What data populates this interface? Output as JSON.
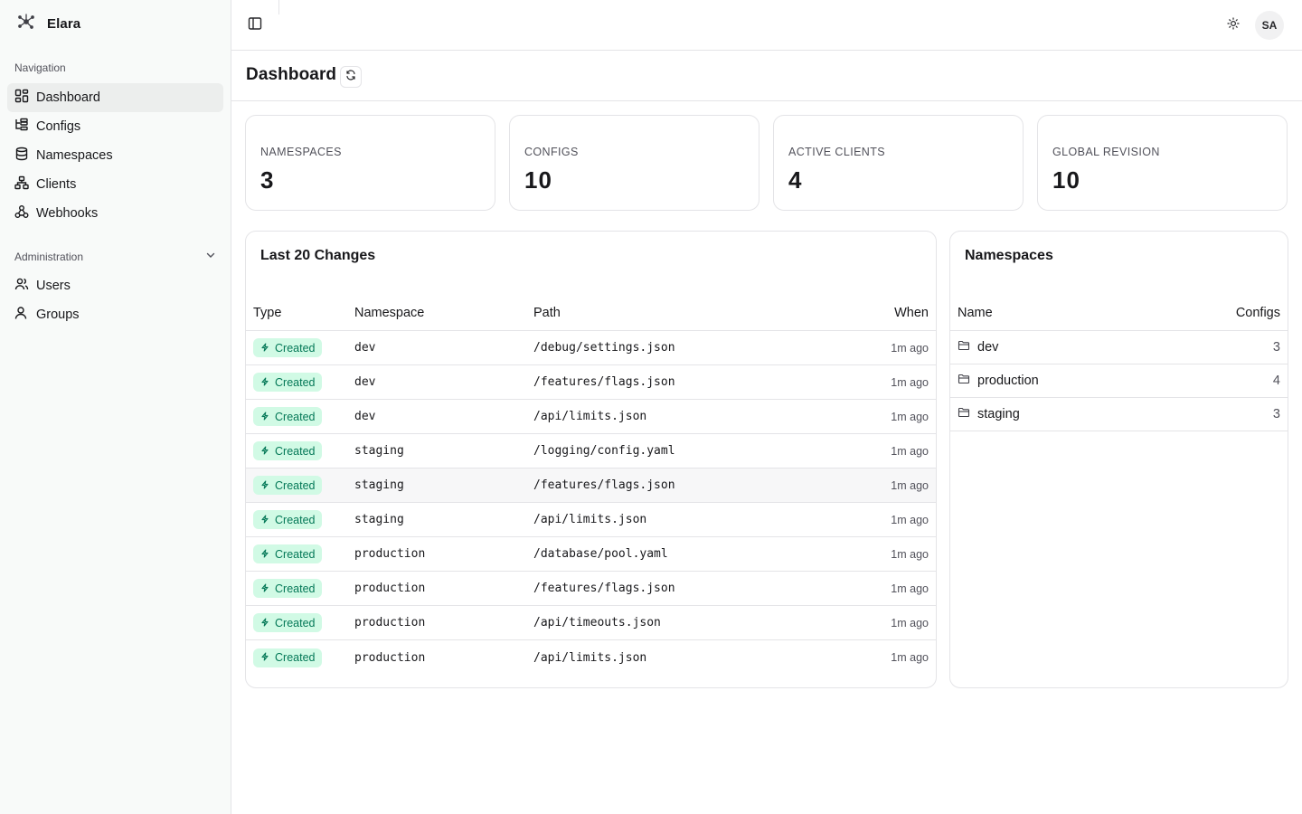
{
  "app": {
    "name": "Elara"
  },
  "sidebar": {
    "navigation_label": "Navigation",
    "items": [
      {
        "label": "Dashboard",
        "icon": "dashboard-icon",
        "active": true
      },
      {
        "label": "Configs",
        "icon": "tree-icon"
      },
      {
        "label": "Namespaces",
        "icon": "database-icon"
      },
      {
        "label": "Clients",
        "icon": "network-icon"
      },
      {
        "label": "Webhooks",
        "icon": "webhook-icon"
      }
    ],
    "administration_label": "Administration",
    "admin_items": [
      {
        "label": "Users",
        "icon": "users-icon"
      },
      {
        "label": "Groups",
        "icon": "user-icon"
      }
    ]
  },
  "topbar": {
    "avatar_initials": "SA"
  },
  "page": {
    "title": "Dashboard"
  },
  "stats": [
    {
      "label": "NAMESPACES",
      "value": "3"
    },
    {
      "label": "CONFIGS",
      "value": "10"
    },
    {
      "label": "ACTIVE CLIENTS",
      "value": "4"
    },
    {
      "label": "GLOBAL REVISION",
      "value": "10"
    }
  ],
  "changes": {
    "title": "Last 20 Changes",
    "columns": [
      "Type",
      "Namespace",
      "Path",
      "When"
    ],
    "rows": [
      {
        "type": "Created",
        "namespace": "dev",
        "path": "/debug/settings.json",
        "when": "1m ago"
      },
      {
        "type": "Created",
        "namespace": "dev",
        "path": "/features/flags.json",
        "when": "1m ago"
      },
      {
        "type": "Created",
        "namespace": "dev",
        "path": "/api/limits.json",
        "when": "1m ago"
      },
      {
        "type": "Created",
        "namespace": "staging",
        "path": "/logging/config.yaml",
        "when": "1m ago"
      },
      {
        "type": "Created",
        "namespace": "staging",
        "path": "/features/flags.json",
        "when": "1m ago"
      },
      {
        "type": "Created",
        "namespace": "staging",
        "path": "/api/limits.json",
        "when": "1m ago"
      },
      {
        "type": "Created",
        "namespace": "production",
        "path": "/database/pool.yaml",
        "when": "1m ago"
      },
      {
        "type": "Created",
        "namespace": "production",
        "path": "/features/flags.json",
        "when": "1m ago"
      },
      {
        "type": "Created",
        "namespace": "production",
        "path": "/api/timeouts.json",
        "when": "1m ago"
      },
      {
        "type": "Created",
        "namespace": "production",
        "path": "/api/limits.json",
        "when": "1m ago"
      }
    ]
  },
  "namespaces": {
    "title": "Namespaces",
    "columns": [
      "Name",
      "Configs"
    ],
    "rows": [
      {
        "name": "dev",
        "configs": "3"
      },
      {
        "name": "production",
        "configs": "4"
      },
      {
        "name": "staging",
        "configs": "3"
      }
    ]
  },
  "colors": {
    "accent_badge_bg": "#d1fae5",
    "accent_badge_text": "#047857",
    "sidebar_bg": "#f8faf9",
    "border": "#e4e4e7"
  }
}
